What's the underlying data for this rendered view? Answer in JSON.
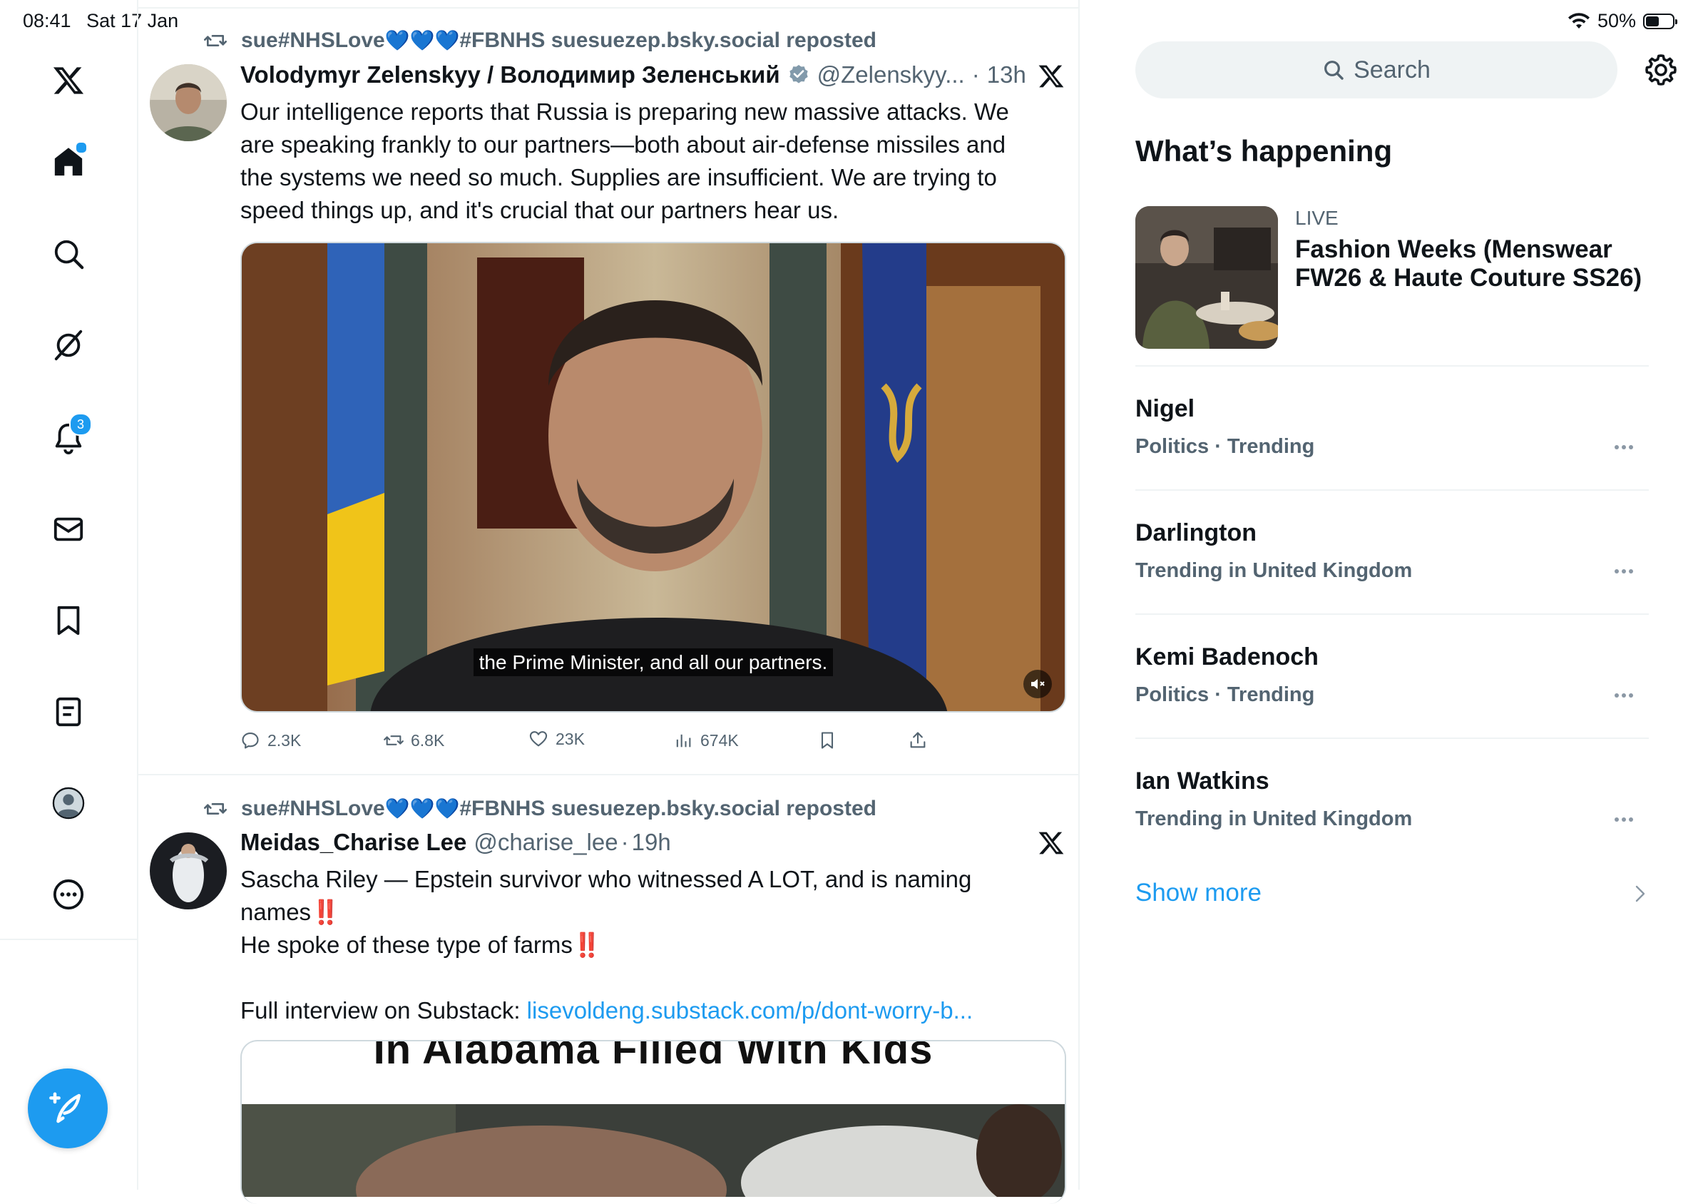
{
  "status_bar": {
    "time": "08:41",
    "date": "Sat 17 Jan",
    "battery": "50%"
  },
  "nav": {
    "notifications_badge": "3",
    "items": [
      "x-logo",
      "home",
      "search",
      "grok",
      "notifications",
      "messages",
      "bookmarks",
      "lists",
      "profile",
      "more"
    ]
  },
  "tweets": [
    {
      "repost_user": "sue#NHSLove",
      "repost_hearts": "💙💙💙",
      "repost_suffix": "#FBNHS suesuezep.bsky.social reposted",
      "name": "Volodymyr Zelenskyy / Володимир Зеленський",
      "handle": "@Zelenskyy...",
      "dot": "·",
      "time": "13h",
      "text_lines": [
        "Our intelligence reports that Russia is preparing new massive attacks. We",
        "are speaking frankly to our partners—both about air-defense missiles and",
        "the systems we need so much. Supplies are insufficient. We are trying to",
        "speed things up, and it's crucial that our partners hear us."
      ],
      "video_caption": "the Prime Minister, and all our partners.",
      "replies": "2.3K",
      "reposts": "6.8K",
      "likes": "23K",
      "views": "674K"
    },
    {
      "repost_user": "sue#NHSLove",
      "repost_hearts": "💙💙💙",
      "repost_suffix": "#FBNHS suesuezep.bsky.social reposted",
      "name": "Meidas_Charise Lee",
      "handle": "@charise_lee",
      "dot": "·",
      "time": "19h",
      "line1": "Sascha Riley — Epstein survivor who witnessed A LOT, and is naming",
      "line2": "names",
      "line3": "He spoke of these type of farms",
      "emphasis": "‼️",
      "line4_prefix": "Full interview on Substack: ",
      "link": "lisevoldeng.substack.com/p/dont-worry-b...",
      "media_caption": "In Alabama Filled With Kids"
    }
  ],
  "sidebar": {
    "search_placeholder": "Search",
    "section_title": "What’s happening",
    "live": {
      "label": "LIVE",
      "title": "Fashion Weeks (Menswear FW26 & Haute Couture SS26)"
    },
    "trends": [
      {
        "name": "Nigel",
        "meta": "Politics · Trending"
      },
      {
        "name": "Darlington",
        "meta": "Trending in United Kingdom"
      },
      {
        "name": "Kemi Badenoch",
        "meta": "Politics · Trending"
      },
      {
        "name": "Ian Watkins",
        "meta": "Trending in United Kingdom"
      }
    ],
    "show_more": "Show more"
  }
}
